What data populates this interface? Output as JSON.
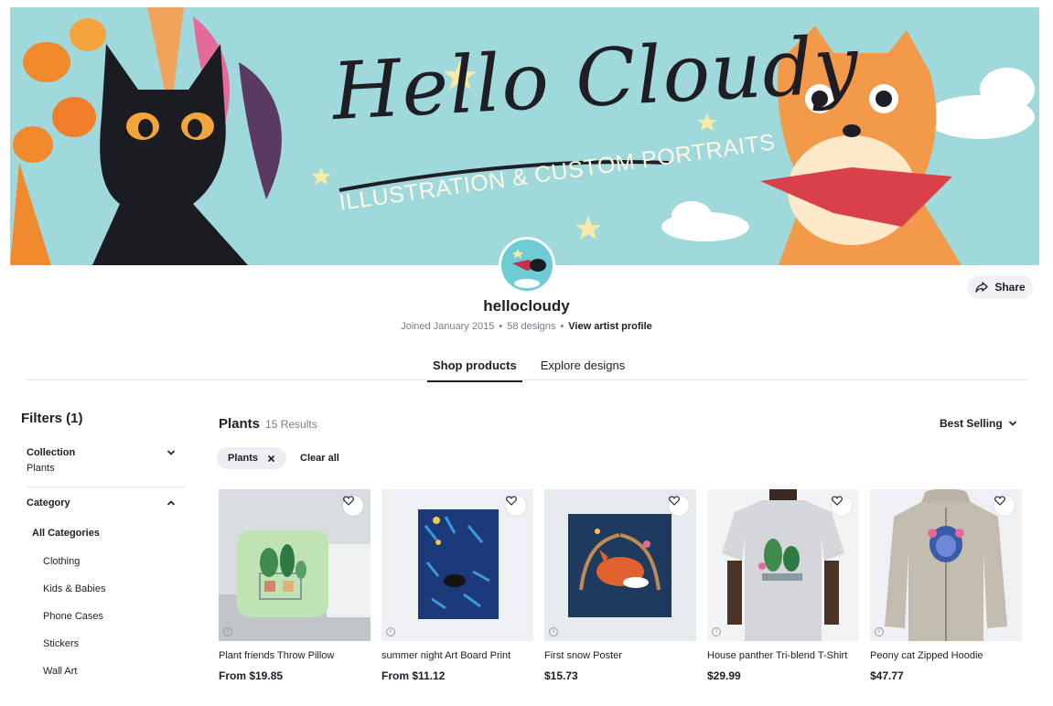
{
  "banner": {
    "title": "Hello Cloudy",
    "subtitle": "ILLUSTRATION & CUSTOM PORTRAITS"
  },
  "profile": {
    "username": "hellocloudy",
    "joined": "Joined January 2015",
    "designs": "58 designs",
    "view_profile": "View artist profile",
    "share_label": "Share"
  },
  "tabs": [
    {
      "label": "Shop products",
      "active": true
    },
    {
      "label": "Explore designs",
      "active": false
    }
  ],
  "sidebar": {
    "filters_title": "Filters (1)",
    "collection": {
      "label": "Collection",
      "value": "Plants"
    },
    "category": {
      "label": "Category",
      "all": "All Categories",
      "items": [
        "Clothing",
        "Kids & Babies",
        "Phone Cases",
        "Stickers",
        "Wall Art"
      ]
    }
  },
  "main": {
    "title": "Plants",
    "count": "15 Results",
    "sort_label": "Best Selling",
    "chip_label": "Plants",
    "clear_all": "Clear all"
  },
  "products": [
    {
      "name": "Plant friends Throw Pillow",
      "price": "From $19.85"
    },
    {
      "name": "summer night Art Board Print",
      "price": "From $11.12"
    },
    {
      "name": "First snow Poster",
      "price": "$15.73"
    },
    {
      "name": "House panther Tri-blend T-Shirt",
      "price": "$29.99"
    },
    {
      "name": "Peony cat Zipped Hoodie",
      "price": "$47.77"
    }
  ],
  "icons": {
    "share": "share-arrow-icon",
    "heart": "heart-outline-icon",
    "info": "info-icon",
    "chevron_down": "chevron-down-icon",
    "chevron_up": "chevron-up-icon",
    "close": "close-icon"
  },
  "colors": {
    "banner_bg": "#9fd9db",
    "text_primary": "#1d1d2b",
    "text_muted": "#7a7a8c",
    "chip_bg": "#eceef3"
  }
}
